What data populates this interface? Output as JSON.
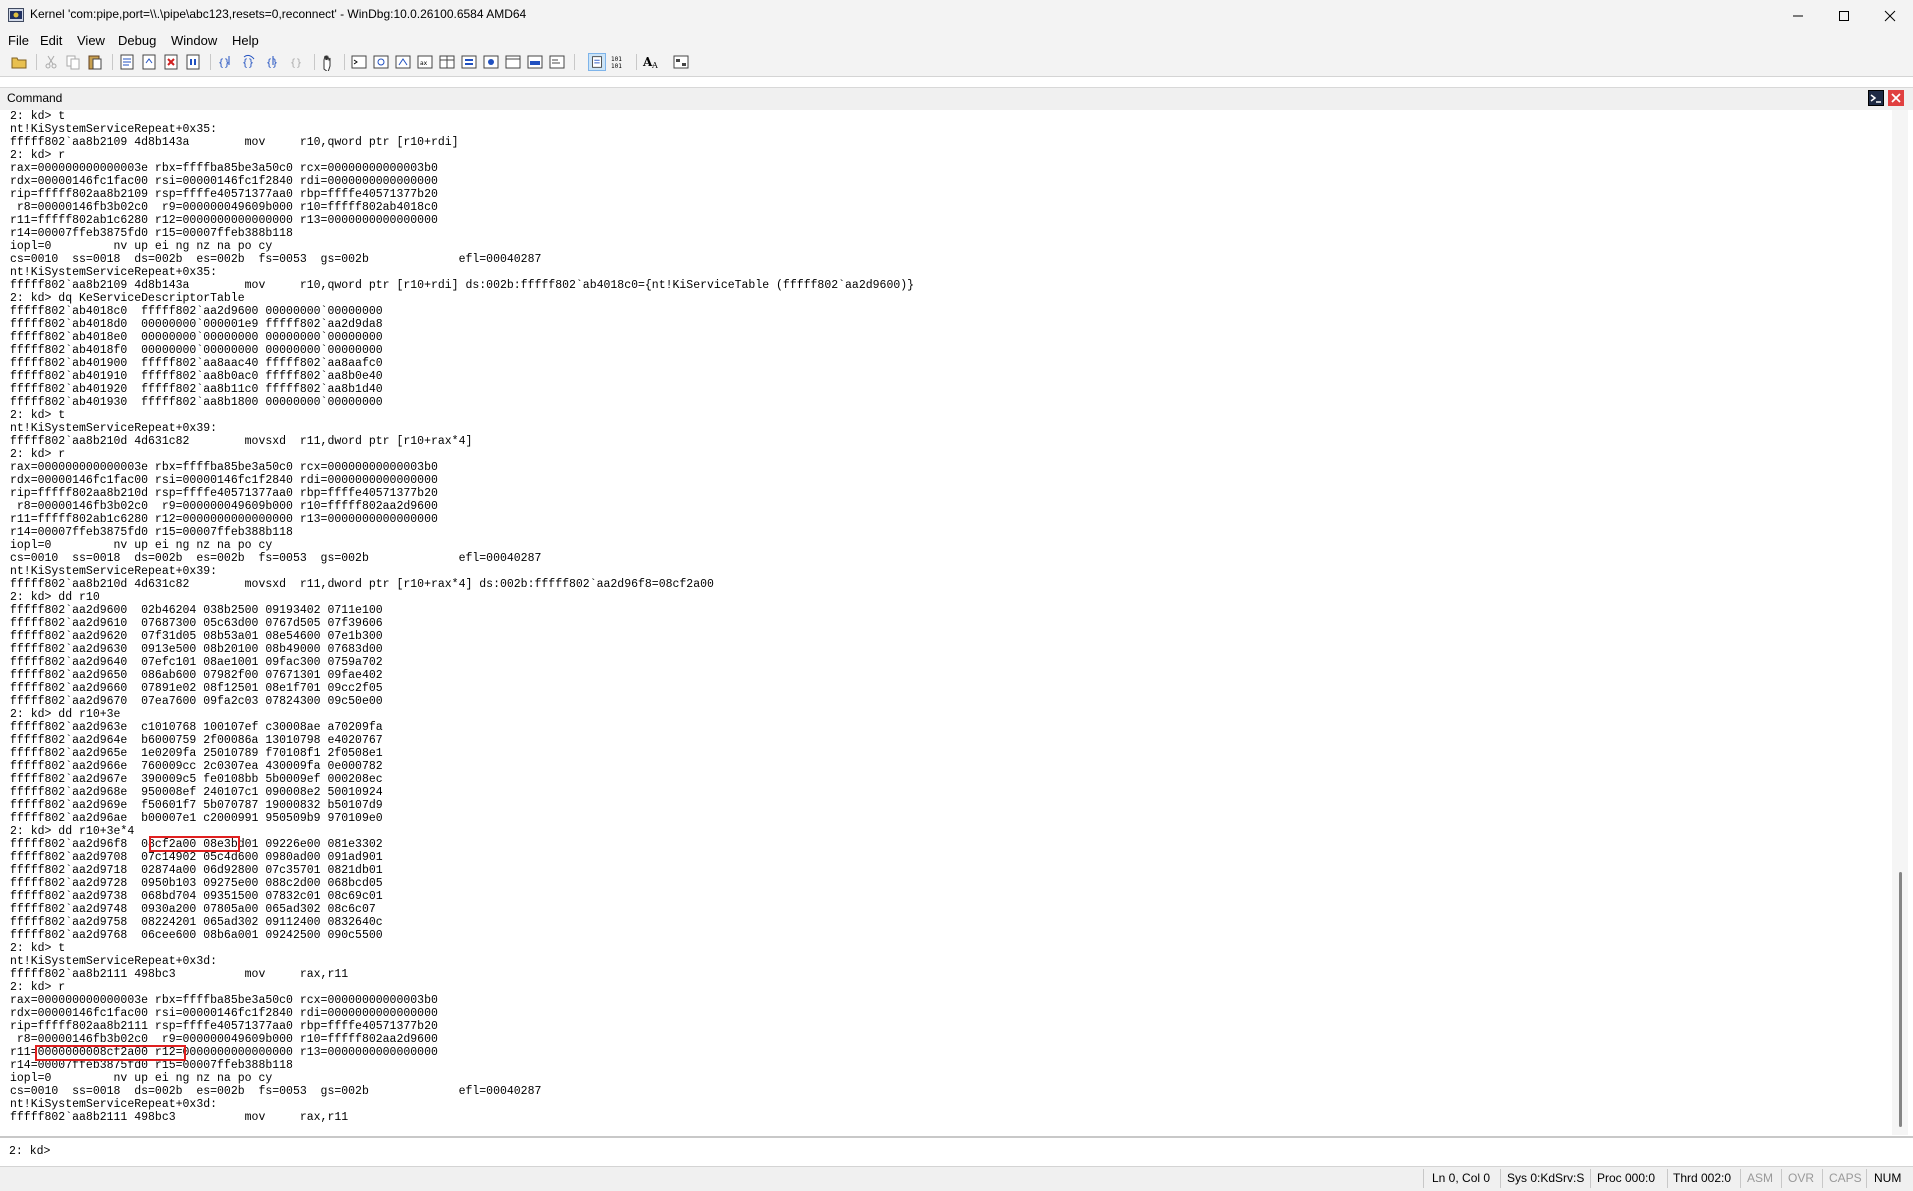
{
  "window": {
    "title": "Kernel 'com:pipe,port=\\\\.\\pipe\\abc123,resets=0,reconnect' - WinDbg:10.0.26100.6584 AMD64",
    "controls": {
      "minimize": "─",
      "maximize": "☐",
      "close": "✕"
    }
  },
  "menu": {
    "items": [
      "File",
      "Edit",
      "View",
      "Debug",
      "Window",
      "Help"
    ]
  },
  "command_window": {
    "title": "Command",
    "lines": [
      "2: kd> t",
      "nt!KiSystemServiceRepeat+0x35:",
      "fffff802`aa8b2109 4d8b143a        mov     r10,qword ptr [r10+rdi]",
      "2: kd> r",
      "rax=000000000000003e rbx=ffffba85be3a50c0 rcx=00000000000003b0",
      "rdx=00000146fc1fac00 rsi=00000146fc1f2840 rdi=0000000000000000",
      "rip=fffff802aa8b2109 rsp=ffffe40571377aa0 rbp=ffffe40571377b20",
      " r8=00000146fb3b02c0  r9=000000049609b000 r10=fffff802ab4018c0",
      "r11=fffff802ab1c6280 r12=0000000000000000 r13=0000000000000000",
      "r14=00007ffeb3875fd0 r15=00007ffeb388b118",
      "iopl=0         nv up ei ng nz na po cy",
      "cs=0010  ss=0018  ds=002b  es=002b  fs=0053  gs=002b             efl=00040287",
      "nt!KiSystemServiceRepeat+0x35:",
      "fffff802`aa8b2109 4d8b143a        mov     r10,qword ptr [r10+rdi] ds:002b:fffff802`ab4018c0={nt!KiServiceTable (fffff802`aa2d9600)}",
      "2: kd> dq KeServiceDescriptorTable",
      "fffff802`ab4018c0  fffff802`aa2d9600 00000000`00000000",
      "fffff802`ab4018d0  00000000`000001e9 fffff802`aa2d9da8",
      "fffff802`ab4018e0  00000000`00000000 00000000`00000000",
      "fffff802`ab4018f0  00000000`00000000 00000000`00000000",
      "fffff802`ab401900  fffff802`aa8aac40 fffff802`aa8aafc0",
      "fffff802`ab401910  fffff802`aa8b0ac0 fffff802`aa8b0e40",
      "fffff802`ab401920  fffff802`aa8b11c0 fffff802`aa8b1d40",
      "fffff802`ab401930  fffff802`aa8b1800 00000000`00000000",
      "2: kd> t",
      "nt!KiSystemServiceRepeat+0x39:",
      "fffff802`aa8b210d 4d631c82        movsxd  r11,dword ptr [r10+rax*4]",
      "2: kd> r",
      "rax=000000000000003e rbx=ffffba85be3a50c0 rcx=00000000000003b0",
      "rdx=00000146fc1fac00 rsi=00000146fc1f2840 rdi=0000000000000000",
      "rip=fffff802aa8b210d rsp=ffffe40571377aa0 rbp=ffffe40571377b20",
      " r8=00000146fb3b02c0  r9=000000049609b000 r10=fffff802aa2d9600",
      "r11=fffff802ab1c6280 r12=0000000000000000 r13=0000000000000000",
      "r14=00007ffeb3875fd0 r15=00007ffeb388b118",
      "iopl=0         nv up ei ng nz na po cy",
      "cs=0010  ss=0018  ds=002b  es=002b  fs=0053  gs=002b             efl=00040287",
      "nt!KiSystemServiceRepeat+0x39:",
      "fffff802`aa8b210d 4d631c82        movsxd  r11,dword ptr [r10+rax*4] ds:002b:fffff802`aa2d96f8=08cf2a00",
      "2: kd> dd r10",
      "fffff802`aa2d9600  02b46204 038b2500 09193402 0711e100",
      "fffff802`aa2d9610  07687300 05c63d00 0767d505 07f39606",
      "fffff802`aa2d9620  07f31d05 08b53a01 08e54600 07e1b300",
      "fffff802`aa2d9630  0913e500 08b20100 08b49000 07683d00",
      "fffff802`aa2d9640  07efc101 08ae1001 09fac300 0759a702",
      "fffff802`aa2d9650  086ab600 07982f00 07671301 09fae402",
      "fffff802`aa2d9660  07891e02 08f12501 08e1f701 09cc2f05",
      "fffff802`aa2d9670  07ea7600 09fa2c03 07824300 09c50e00",
      "2: kd> dd r10+3e",
      "fffff802`aa2d963e  c1010768 100107ef c30008ae a70209fa",
      "fffff802`aa2d964e  b6000759 2f00086a 13010798 e4020767",
      "fffff802`aa2d965e  1e0209fa 25010789 f70108f1 2f0508e1",
      "fffff802`aa2d966e  760009cc 2c0307ea 430009fa 0e000782",
      "fffff802`aa2d967e  390009c5 fe0108bb 5b0009ef 000208ec",
      "fffff802`aa2d968e  950008ef 240107c1 090008e2 50010924",
      "fffff802`aa2d969e  f50601f7 5b070787 19000832 b50107d9",
      "fffff802`aa2d96ae  b00007e1 c2000991 950509b9 970109e0",
      "2: kd> dd r10+3e*4",
      "fffff802`aa2d96f8  08cf2a00 08e3bd01 09226e00 081e3302",
      "fffff802`aa2d9708  07c14902 05c4d600 0980ad00 091ad901",
      "fffff802`aa2d9718  02874a00 06d92800 07c35701 0821db01",
      "fffff802`aa2d9728  0950b103 09275e00 088c2d00 068bcd05",
      "fffff802`aa2d9738  068bd704 09351500 07832c01 08c69c01",
      "fffff802`aa2d9748  0930a200 07805a00 065ad302 08c6c07",
      "fffff802`aa2d9758  08224201 065ad302 09112400 0832640c",
      "fffff802`aa2d9768  06cee600 08b6a001 09242500 090c5500",
      "2: kd> t",
      "nt!KiSystemServiceRepeat+0x3d:",
      "fffff802`aa8b2111 498bc3          mov     rax,r11",
      "2: kd> r",
      "rax=000000000000003e rbx=ffffba85be3a50c0 rcx=00000000000003b0",
      "rdx=00000146fc1fac00 rsi=00000146fc1f2840 rdi=0000000000000000",
      "rip=fffff802aa8b2111 rsp=ffffe40571377aa0 rbp=ffffe40571377b20",
      " r8=00000146fb3b02c0  r9=000000049609b000 r10=fffff802aa2d9600",
      "r11=0000000008cf2a00 r12=0000000000000000 r13=0000000000000000",
      "r14=00007ffeb3875fd0 r15=00007ffeb388b118",
      "iopl=0         nv up ei ng nz na po cy",
      "cs=0010  ss=0018  ds=002b  es=002b  fs=0053  gs=002b             efl=00040287",
      "nt!KiSystemServiceRepeat+0x3d:",
      "fffff802`aa8b2111 498bc3          mov     rax,r11"
    ],
    "prompt": "2: kd>",
    "input_value": ""
  },
  "highlight_color": "#e02020",
  "statusbar": {
    "position": "Ln 0, Col 0",
    "sys": "Sys 0:KdSrv:S",
    "proc": "Proc 000:0",
    "thrd": "Thrd 002:0",
    "asm": "ASM",
    "ovr": "OVR",
    "caps": "CAPS",
    "num": "NUM"
  }
}
